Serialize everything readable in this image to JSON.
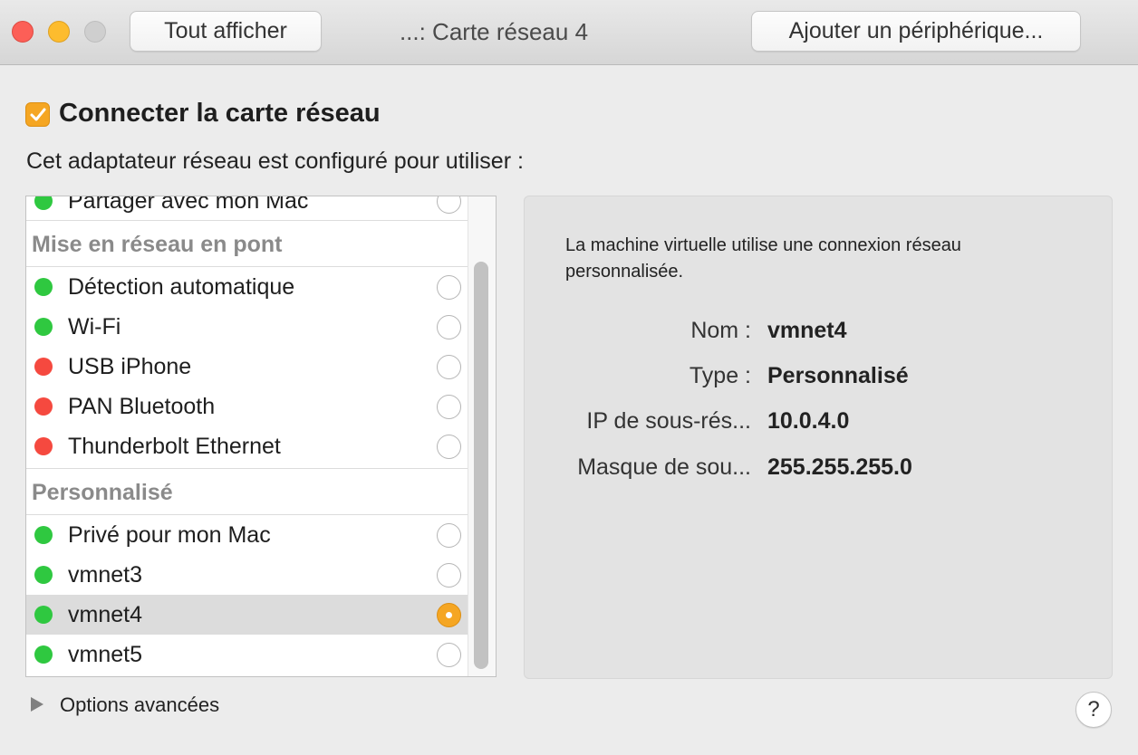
{
  "window": {
    "title": "...: Carte réseau 4",
    "show_all_label": "Tout afficher",
    "add_device_label": "Ajouter un périphérique..."
  },
  "connect": {
    "label": "Connecter la carte réseau",
    "checked": true
  },
  "subtitle": "Cet adaptateur réseau est configuré pour utiliser :",
  "colors": {
    "accent": "#f5a623",
    "status_green": "#2fc840",
    "status_red": "#f5493f"
  },
  "list": {
    "partial_top": {
      "label": "Partager avec mon Mac",
      "status": "green"
    },
    "sections": [
      {
        "header": "Mise en réseau en pont",
        "items": [
          {
            "label": "Détection automatique",
            "status": "green",
            "selected": false
          },
          {
            "label": "Wi-Fi",
            "status": "green",
            "selected": false
          },
          {
            "label": "USB iPhone",
            "status": "red",
            "selected": false
          },
          {
            "label": "PAN Bluetooth",
            "status": "red",
            "selected": false
          },
          {
            "label": "Thunderbolt Ethernet",
            "status": "red",
            "selected": false
          }
        ]
      },
      {
        "header": "Personnalisé",
        "items": [
          {
            "label": "Privé pour mon Mac",
            "status": "green",
            "selected": false
          },
          {
            "label": "vmnet3",
            "status": "green",
            "selected": false
          },
          {
            "label": "vmnet4",
            "status": "green",
            "selected": true
          },
          {
            "label": "vmnet5",
            "status": "green",
            "selected": false
          }
        ]
      }
    ]
  },
  "details": {
    "description": "La machine virtuelle utilise une connexion réseau personnalisée.",
    "fields": [
      {
        "key": "Nom :",
        "value": "vmnet4"
      },
      {
        "key": "Type :",
        "value": "Personnalisé"
      },
      {
        "key": "IP de sous-rés...",
        "value": "10.0.4.0"
      },
      {
        "key": "Masque de sou...",
        "value": "255.255.255.0"
      }
    ]
  },
  "footer": {
    "advanced_label": "Options avancées",
    "help_label": "?"
  }
}
